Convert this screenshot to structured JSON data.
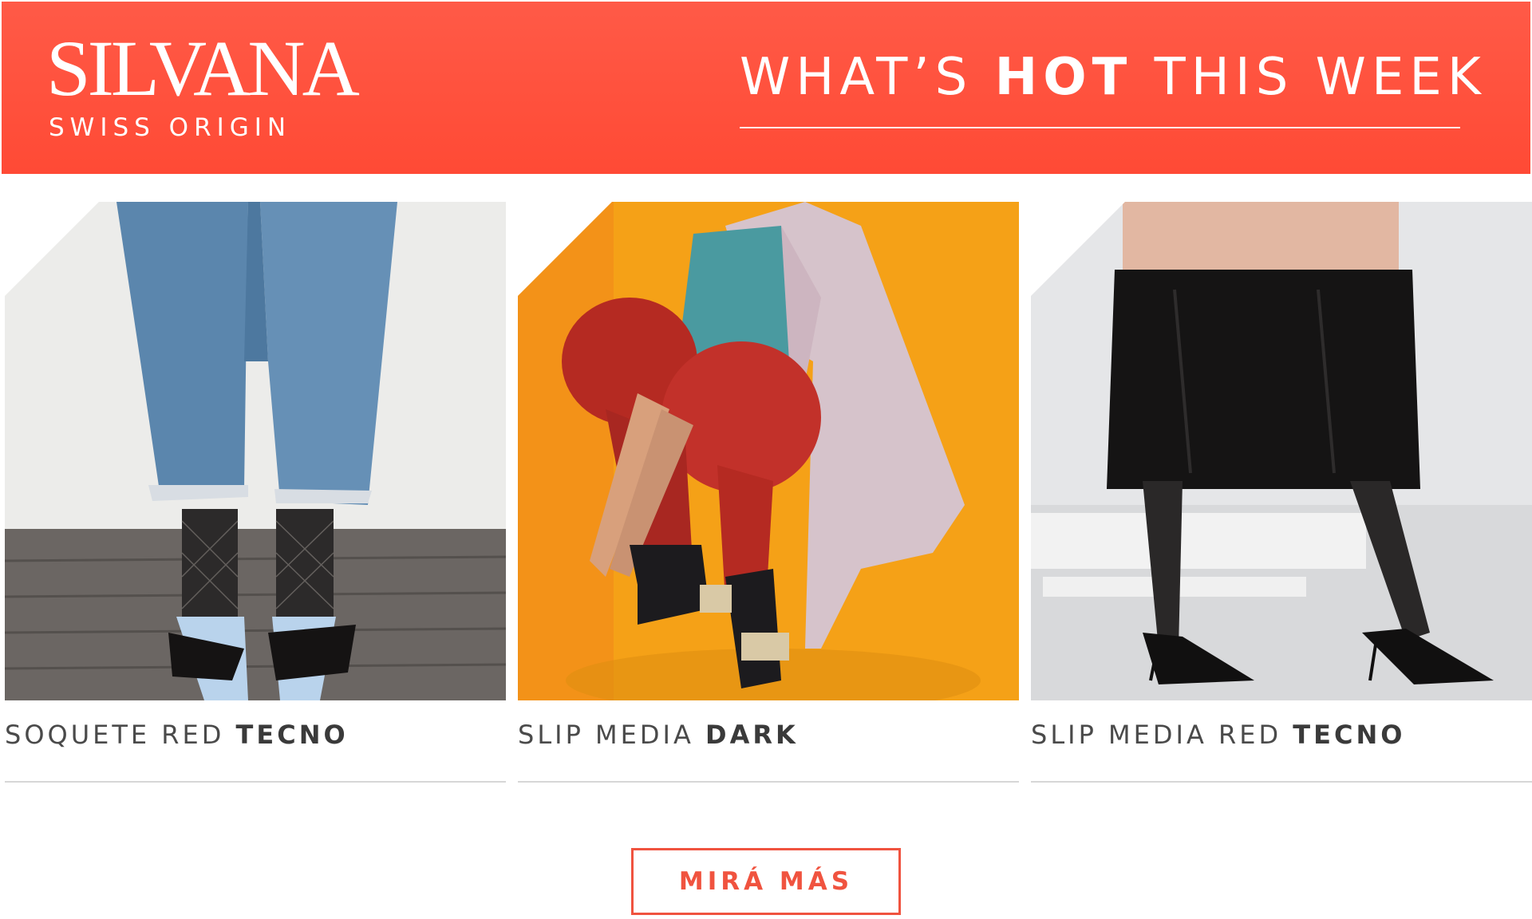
{
  "brand": {
    "name": "SILVANA",
    "tagline": "SWISS ORIGIN"
  },
  "headline": {
    "part1": "WHAT’S ",
    "emphasis": "HOT",
    "part2": " THIS WEEK"
  },
  "products": [
    {
      "name_light": "SOQUETE RED ",
      "name_bold": "TECNO"
    },
    {
      "name_light": "SLIP MEDIA ",
      "name_bold": "DARK"
    },
    {
      "name_light": "SLIP MEDIA RED ",
      "name_bold": "TECNO"
    }
  ],
  "cta": {
    "label": "MIRÁ MÁS"
  },
  "colors": {
    "brand_orange": "#ff4f3b",
    "cta_accent": "#f0533f",
    "caption_text": "#4a4a4a",
    "divider": "#d7d7d7"
  }
}
